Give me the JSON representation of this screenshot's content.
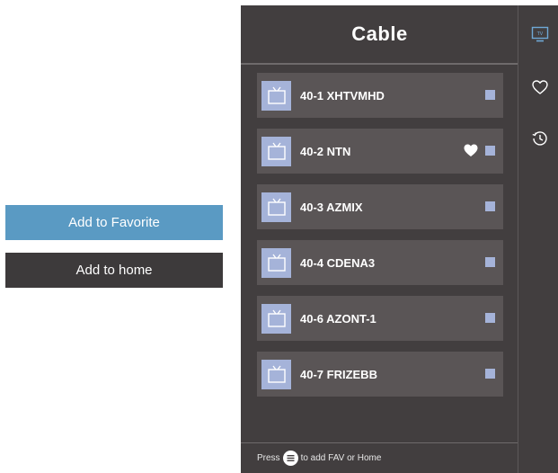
{
  "menu": {
    "add_favorite": "Add to Favorite",
    "add_home": "Add to home"
  },
  "panel": {
    "title": "Cable",
    "channels": [
      {
        "name": "40-1 XHTVMHD",
        "favorite": false
      },
      {
        "name": "40-2 NTN",
        "favorite": true
      },
      {
        "name": "40-3 AZMIX",
        "favorite": false
      },
      {
        "name": "40-4 CDENA3",
        "favorite": false
      },
      {
        "name": "40-6 AZONT-1",
        "favorite": false
      },
      {
        "name": "40-7 FRIZEBB",
        "favorite": false
      }
    ],
    "footer_press": "Press",
    "footer_action": "to add FAV or Home"
  },
  "rail": {
    "tv_label": "TV",
    "icons": [
      "tv-icon",
      "heart-outline-icon",
      "history-icon"
    ]
  },
  "colors": {
    "panel_bg": "#423e3f",
    "row_bg": "#5a5556",
    "accent_blue": "#5a9ac3",
    "thumb_blue": "#a5b3d9",
    "menu_dark": "#3d3a3b"
  }
}
